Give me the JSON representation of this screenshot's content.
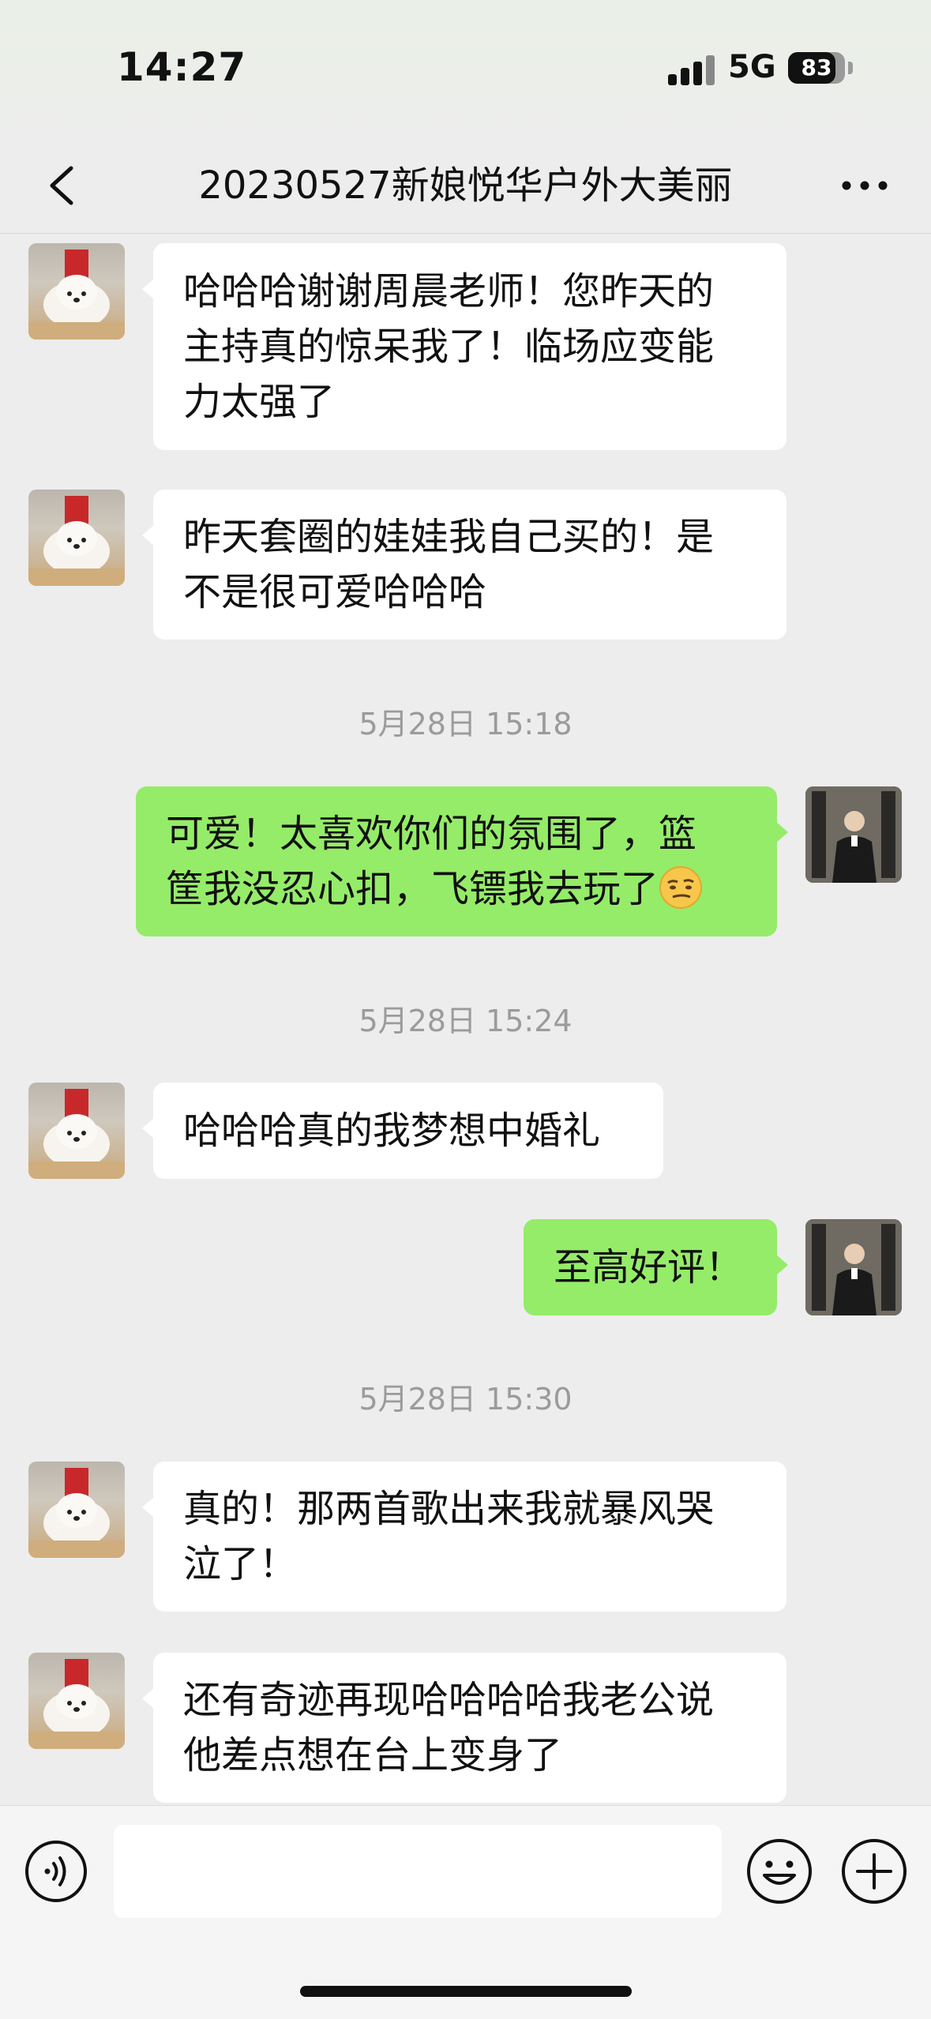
{
  "status_bar": {
    "time": "14:27",
    "network": "5G",
    "battery": "83",
    "battery_level": 0.83
  },
  "nav": {
    "title": "20230527新娘悦华户外大美丽",
    "back_icon": "chevron-left-icon",
    "more_icon": "more-dots-icon"
  },
  "messages": [
    {
      "type": "received",
      "lines": [
        "哈哈哈谢谢周晨老师！您昨天的",
        "主持真的惊呆我了！临场应变能",
        "力太强了"
      ]
    },
    {
      "type": "received",
      "lines": [
        "昨天套圈的娃娃我自己买的！是",
        "不是很可爱哈哈哈"
      ]
    },
    {
      "type": "timestamp",
      "text": "5月28日 15:18"
    },
    {
      "type": "sent",
      "lines": [
        "可爱！太喜欢你们的氛围了，篮",
        "筐我没忍心扣，飞镖我去玩了"
      ],
      "emoji": "smirk-emoji"
    },
    {
      "type": "timestamp",
      "text": "5月28日 15:24"
    },
    {
      "type": "received",
      "lines": [
        "哈哈哈真的我梦想中婚礼"
      ]
    },
    {
      "type": "sent",
      "lines": [
        "至高好评！"
      ]
    },
    {
      "type": "timestamp",
      "text": "5月28日 15:30"
    },
    {
      "type": "received",
      "lines": [
        "真的！那两首歌出来我就暴风哭",
        "泣了！"
      ]
    },
    {
      "type": "received",
      "lines": [
        "还有奇迹再现哈哈哈哈我老公说",
        "他差点想在台上变身了"
      ]
    }
  ],
  "input_bar": {
    "value": "",
    "voice_icon": "voice-icon",
    "emoji_icon": "emoji-icon",
    "plus_icon": "plus-icon"
  },
  "colors": {
    "sent_bubble": "#95ec69",
    "received_bubble": "#ffffff",
    "background": "#ededed"
  }
}
